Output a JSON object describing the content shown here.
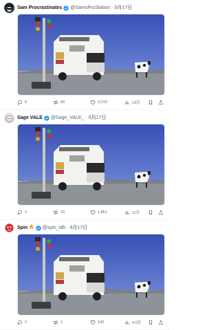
{
  "posts": [
    {
      "display_name": "Sam Procrastinates",
      "handle": "@SamsProStation",
      "date": "9月17日",
      "verified": true,
      "emoji": "",
      "avatar": "hat-avatar",
      "metrics": {
        "replies": "8",
        "reposts": "83",
        "likes": "3,210",
        "views": "13万"
      }
    },
    {
      "display_name": "Sage VALE",
      "handle": "@Sage_VALE_",
      "date": "9月17日",
      "verified": true,
      "emoji": "",
      "avatar": "anime-avatar",
      "metrics": {
        "replies": "2",
        "reposts": "10",
        "likes": "1,861",
        "views": "11万"
      }
    },
    {
      "display_name": "Spin",
      "handle": "@spin_tdh",
      "date": "9月17日",
      "verified": true,
      "emoji": "🔥",
      "avatar": "red-avatar",
      "metrics": {
        "replies": "2",
        "reposts": "1",
        "likes": "142",
        "views": "4.5万"
      }
    }
  ],
  "separator": "·",
  "colors": {
    "verified": "#1d9bf0",
    "muted": "#536471",
    "sky": "#4a63c4",
    "ground": "#8e939a"
  }
}
